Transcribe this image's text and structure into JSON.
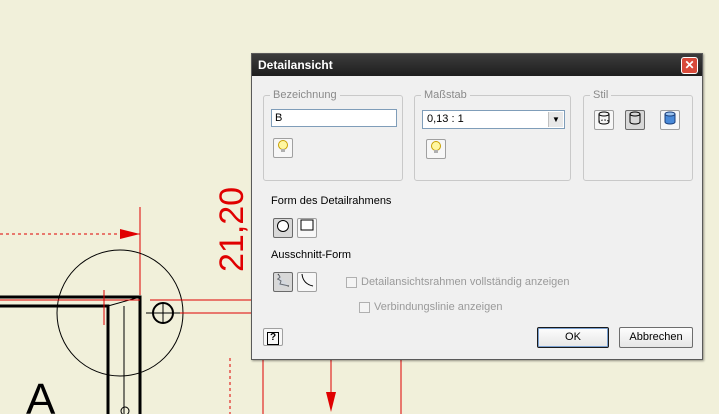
{
  "drawing": {
    "dimension_text": "21,20",
    "view_letter": "A"
  },
  "dialog": {
    "title": "Detailansicht",
    "close_glyph": "✕",
    "bezeichnung": {
      "group_label": "Bezeichnung",
      "value": "B",
      "lightbulb_icon": "lightbulb-icon"
    },
    "massstab": {
      "group_label": "Maßstab",
      "value": "0,13 : 1",
      "arrow_glyph": "▼",
      "lightbulb_icon": "lightbulb-icon"
    },
    "stil": {
      "group_label": "Stil",
      "icons": [
        "hidden-lines-style-icon",
        "visible-lines-style-icon",
        "shaded-style-icon"
      ]
    },
    "detailrahmen": {
      "label": "Form des Detailrahmens",
      "options": [
        "circle-frame-icon",
        "rectangle-frame-icon"
      ],
      "selected": "circle"
    },
    "ausschnitt": {
      "label": "Ausschnitt-Form",
      "options": [
        "jagged-cutout-icon",
        "smooth-cutout-icon"
      ],
      "selected": "jagged"
    },
    "checkbox_full_frame": "Detailansichtsrahmen vollständig anzeigen",
    "checkbox_connection_line": "Verbindungslinie anzeigen",
    "help_icon": "help-icon",
    "help_glyph": "?",
    "ok_label": "OK",
    "cancel_label": "Abbrechen",
    "colors": {
      "title_bar": "#2a2a2a",
      "close": "#d84a3a",
      "drawing_red": "#e00000"
    }
  }
}
